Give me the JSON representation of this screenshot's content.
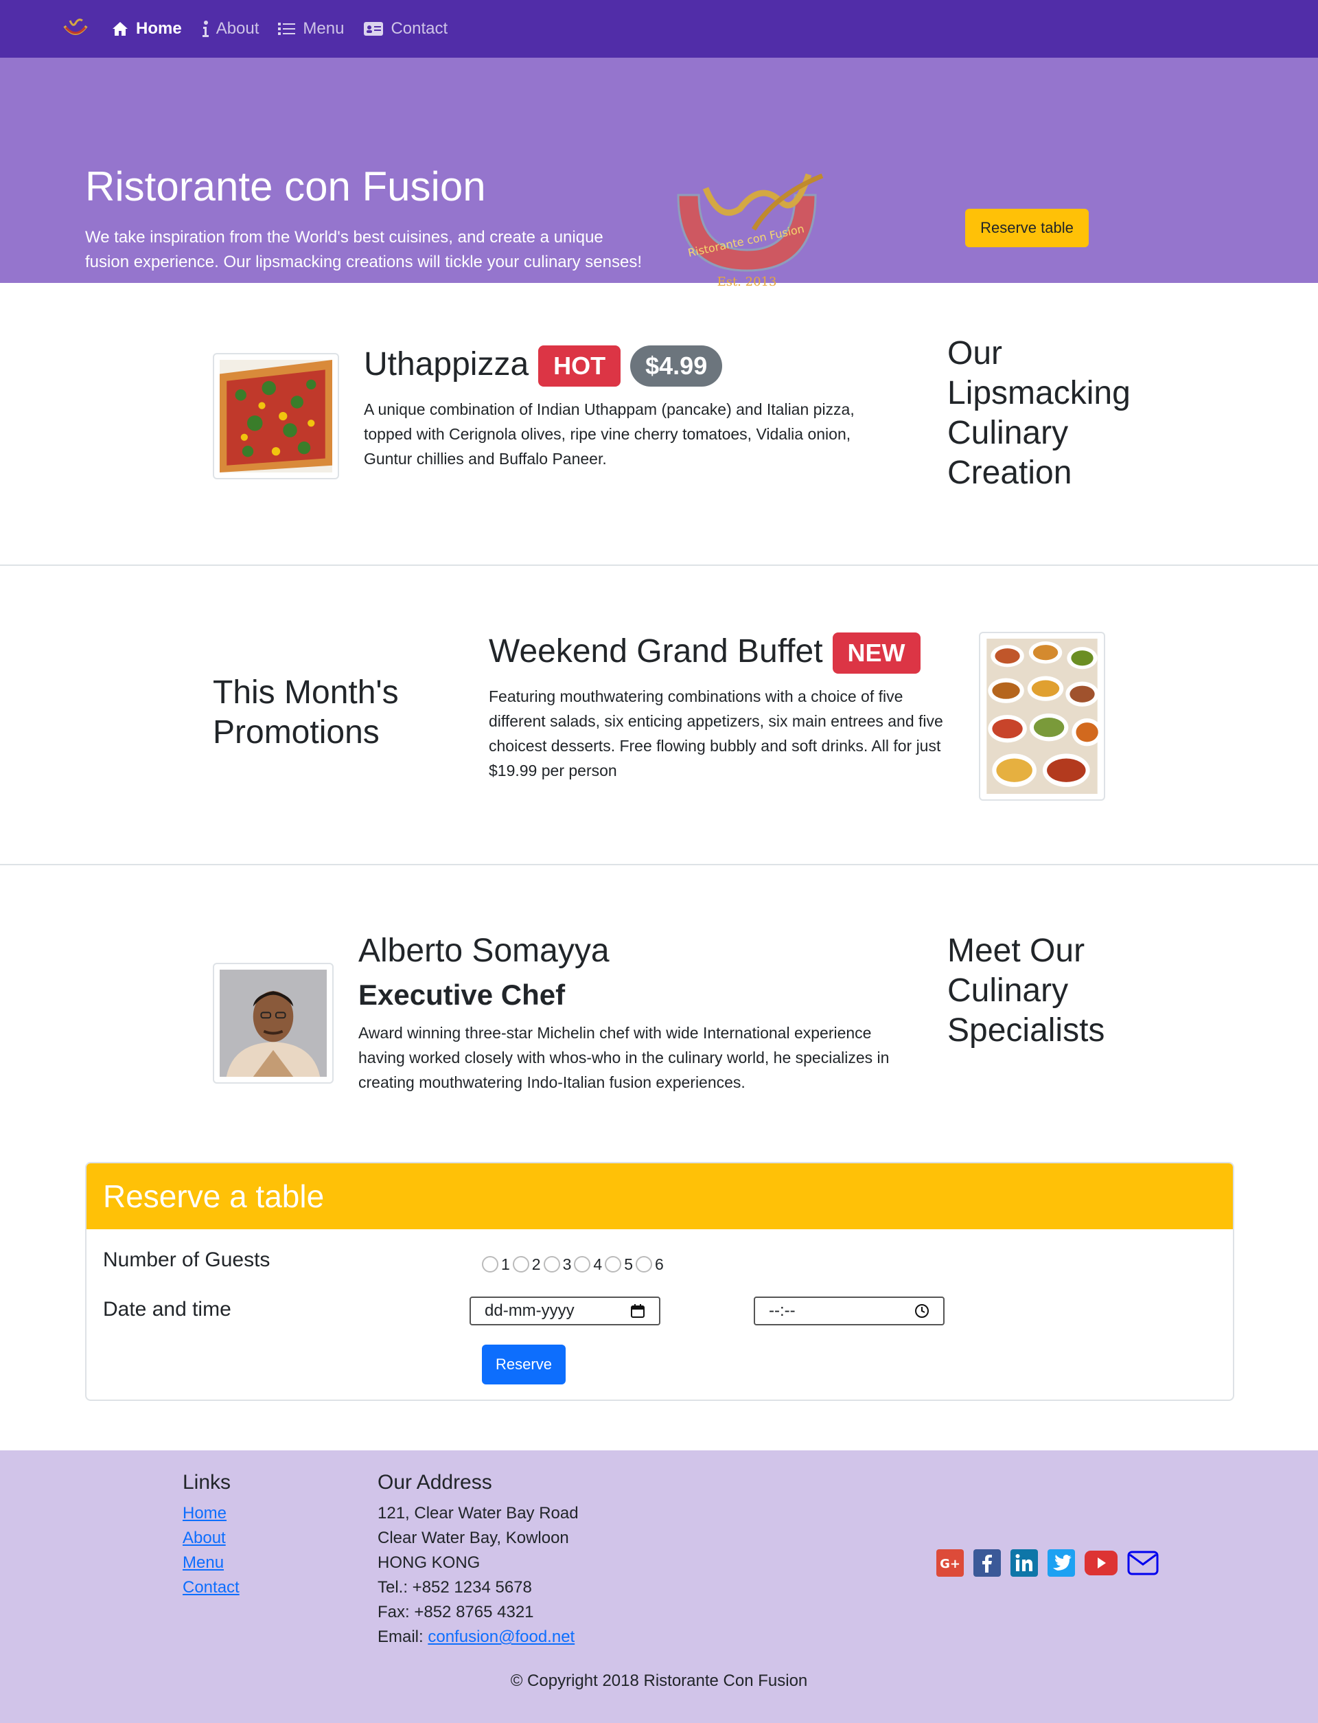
{
  "navbar": {
    "items": [
      {
        "label": "Home",
        "icon": "home-icon",
        "active": true
      },
      {
        "label": "About",
        "icon": "info-icon",
        "active": false
      },
      {
        "label": "Menu",
        "icon": "list-icon",
        "active": false
      },
      {
        "label": "Contact",
        "icon": "address-card-icon",
        "active": false
      }
    ]
  },
  "jumbotron": {
    "title": "Ristorante con Fusion",
    "text": "We take inspiration from the World's best cuisines, and create a unique fusion experience. Our lipsmacking creations will tickle your culinary senses!",
    "logo_text": "Ristorante con Fusion",
    "logo_est": "Est. 2013",
    "reserve_button": "Reserve table"
  },
  "dish": {
    "name": "Uthappizza",
    "badge": "HOT",
    "price": "$4.99",
    "description": "A unique combination of Indian Uthappam (pancake) and Italian pizza, topped with Cerignola olives, ripe vine cherry tomatoes, Vidalia onion, Guntur chillies and Buffalo Paneer.",
    "side_heading": "Our Lipsmacking Culinary Creation"
  },
  "promotion": {
    "side_heading": "This Month's Promotions",
    "name": "Weekend Grand Buffet",
    "badge": "NEW",
    "description": "Featuring mouthwatering combinations with a choice of five different salads, six enticing appetizers, six main entrees and five choicest desserts. Free flowing bubbly and soft drinks. All for just $19.99 per person"
  },
  "leader": {
    "name": "Alberto Somayya",
    "designation": "Executive Chef",
    "description": "Award winning three-star Michelin chef with wide International experience having worked closely with whos-who in the culinary world, he specializes in creating mouthwatering Indo-Italian fusion experiences.",
    "side_heading": "Meet Our Culinary Specialists"
  },
  "reservation": {
    "title": "Reserve a table",
    "guests_label": "Number of Guests",
    "guest_options": [
      "1",
      "2",
      "3",
      "4",
      "5",
      "6"
    ],
    "datetime_label": "Date and time",
    "date_placeholder": "dd-mm-yyyy",
    "time_placeholder": "--:--",
    "submit": "Reserve"
  },
  "footer": {
    "links_heading": "Links",
    "links": [
      "Home",
      "About",
      "Menu",
      "Contact"
    ],
    "address_heading": "Our Address",
    "address_lines": [
      "121, Clear Water Bay Road",
      "Clear Water Bay, Kowloon",
      "HONG KONG"
    ],
    "tel": "Tel.: +852 1234 5678",
    "fax": "Fax: +852 8765 4321",
    "email_label": "Email: ",
    "email": "confusion@food.net",
    "social": [
      "google-plus-icon",
      "facebook-icon",
      "linkedin-icon",
      "twitter-icon",
      "youtube-icon",
      "email-icon"
    ],
    "copyright": "© Copyright 2018 Ristorante Con Fusion"
  },
  "colors": {
    "navbar": "#512da8",
    "jumbotron": "#9575cd",
    "footer": "#d1c4e9",
    "warning": "#ffc107",
    "danger": "#dc3545",
    "primary": "#0d6efd"
  }
}
